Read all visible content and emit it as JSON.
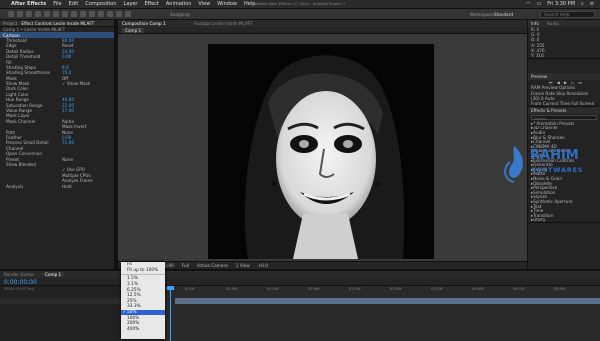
{
  "menubar": {
    "app": "After Effects",
    "items": [
      "File",
      "Edit",
      "Composition",
      "Layer",
      "Effect",
      "Animation",
      "View",
      "Window",
      "Help"
    ],
    "window_title": "Adobe After Effects CC 2014 - Untitled Project *",
    "clock": "Fri 3:30 PM"
  },
  "toolbar": {
    "snapping": "Snapping",
    "workspace_label": "Workspace:",
    "workspace_value": "Standard",
    "search_placeholder": "Search Help"
  },
  "left_panel": {
    "tabs": [
      "Project",
      "Effect Controls Leslie Inside MLAFT"
    ],
    "header": "Comp 1 • Leslie Inside MLAFT",
    "effect_name": "Cartoon",
    "controls": [
      {
        "label": "Threshold",
        "value": "80.00",
        "blue": true
      },
      {
        "label": "Edge",
        "value": "Reset",
        "blue": false
      },
      {
        "label": "Detail Radius",
        "value": "24.00",
        "blue": true
      },
      {
        "label": "Detail Threshold",
        "value": "0.00",
        "blue": true
      },
      {
        "label": "Fill",
        "value": "",
        "blue": false
      },
      {
        "label": "Shading Steps",
        "value": "8.0",
        "blue": true
      },
      {
        "label": "Shading Smoothness",
        "value": "70.0",
        "blue": true
      },
      {
        "label": "Mask",
        "value": "Off",
        "blue": false
      },
      {
        "label": "Show Mask",
        "value": "✓ Show Mask",
        "blue": false
      },
      {
        "label": "Dark Color",
        "value": "",
        "blue": false
      },
      {
        "label": "Light Color",
        "value": "",
        "blue": false
      },
      {
        "label": "Hue Range",
        "value": "40.00",
        "blue": true
      },
      {
        "label": "Saturation Range",
        "value": "22.00",
        "blue": true
      },
      {
        "label": "Value Range",
        "value": "17.00",
        "blue": true
      },
      {
        "label": "Mask Layer",
        "value": "",
        "blue": false
      },
      {
        "label": "Mask Channel",
        "value": "Alpha",
        "blue": false
      },
      {
        "label": "",
        "value": "Mask Invert",
        "blue": false
      },
      {
        "label": "Path",
        "value": "None",
        "blue": false
      },
      {
        "label": "Feather",
        "value": "0.00",
        "blue": true
      },
      {
        "label": "Process Small Detail",
        "value": "71.00",
        "blue": true
      },
      {
        "label": "Channel",
        "value": "",
        "blue": false
      },
      {
        "label": "Open Conversion",
        "value": "",
        "blue": false
      },
      {
        "label": "Preset",
        "value": "None",
        "blue": false
      },
      {
        "label": "Show Blended",
        "value": "",
        "blue": false
      },
      {
        "label": "",
        "value": "✓ Use GPU",
        "blue": false
      },
      {
        "label": "",
        "value": "Multiple CPUs",
        "blue": false
      },
      {
        "label": "",
        "value": "Analyze Frame",
        "blue": false
      },
      {
        "label": "Analysis",
        "value": "Hold",
        "blue": false
      }
    ]
  },
  "composition": {
    "tab": "Composition Comp 1",
    "footage_tab": "Footage Leslie Inside MLAFT",
    "sub_tab": "Comp 1",
    "viewer_controls": [
      "50%",
      "0;00;00;00",
      "Full",
      "Active Camera",
      "1 View",
      "+0.0"
    ]
  },
  "right_panel": {
    "info": {
      "title": "Info",
      "tab2": "Audio",
      "rows": [
        "R: 0",
        "G: 0",
        "B: 0",
        "A: 255",
        "X: 476",
        "Y: 316"
      ]
    },
    "preview": {
      "title": "Preview",
      "rows": [
        "RAM Preview Options",
        "Frame Rate   Skip   Resolution",
        "(30)     0    Auto",
        "From Current Time     Full Screen"
      ]
    },
    "effects": {
      "title": "Effects & Presets",
      "search_placeholder": "Search",
      "categories": [
        "* Animation Presets",
        "3D Channel",
        "Audio",
        "Blur & Sharpen",
        "Channel",
        "CINEMA 4D",
        "Color Correction",
        "Distort",
        "Expression Controls",
        "Generate",
        "Keying",
        "Matte",
        "Noise & Grain",
        "Obsolete",
        "Perspective",
        "Simulation",
        "Stylize",
        "Synthetic Aperture",
        "Text",
        "Time",
        "Transition",
        "Utility"
      ]
    }
  },
  "timeline": {
    "tabs": [
      "Render Queue",
      "Comp 1"
    ],
    "timecode": "0;00;00;00",
    "fps": "00000 (29.97 fps)",
    "ruler": [
      "0:15f",
      "01:00f",
      "01:15f",
      "02:00f",
      "02:15f",
      "03:00f",
      "03:15f",
      "04:00f",
      "04:15f",
      "05:00f"
    ]
  },
  "zoom_menu": {
    "items": [
      "Fit",
      "Fit up to 100%",
      "---",
      "1.5%",
      "3.1%",
      "6.25%",
      "12.5%",
      "25%",
      "33.3%",
      "50%",
      "100%",
      "200%",
      "400%"
    ],
    "selected": "50%"
  },
  "watermark": {
    "line1": "RAHIM",
    "line2": "SOFTWARES"
  }
}
